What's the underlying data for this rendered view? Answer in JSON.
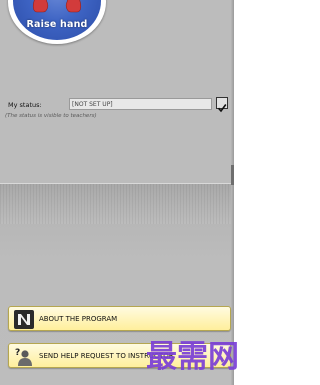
{
  "raise_hand": {
    "label": "Raise hand"
  },
  "status": {
    "label": "My status:",
    "value": "[NOT SET UP]",
    "hint": "(The status is visible to teachers)",
    "checked": true
  },
  "buttons": {
    "about": {
      "label": "ABOUT THE PROGRAM",
      "icon": "about-n-icon"
    },
    "help": {
      "label": "SEND HELP REQUEST TO INSTRUCTOR",
      "icon": "help-user-icon"
    }
  },
  "watermark": {
    "text": "最需网"
  },
  "colors": {
    "panel": "#bcbcbc",
    "button_fill": "#ffef9c",
    "raise_hand_blue": "#3e64c4",
    "watermark_purple": "#7a3fd6"
  }
}
